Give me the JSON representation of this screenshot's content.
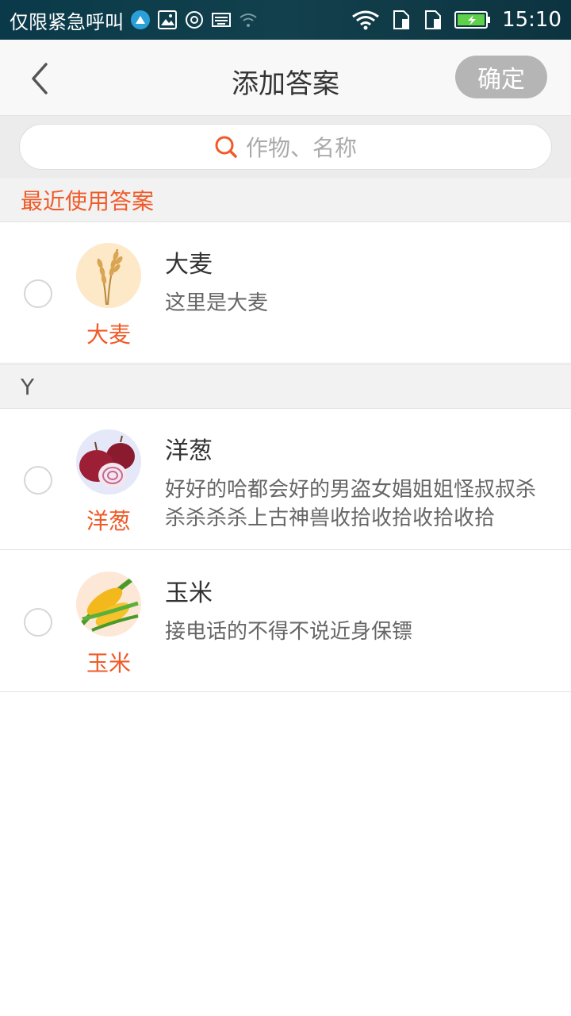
{
  "status_bar": {
    "carrier_text": "仅限紧急呼叫",
    "time": "15:10",
    "icons": [
      "cleaner-icon",
      "image-icon",
      "security-icon",
      "keyboard-icon",
      "wifi-question-icon",
      "wifi-icon",
      "sim1-icon",
      "sim2-icon",
      "battery-icon"
    ]
  },
  "nav": {
    "title": "添加答案",
    "confirm_label": "确定"
  },
  "search": {
    "placeholder": "作物、名称"
  },
  "sections": {
    "recent_label": "最近使用答案",
    "y_label": "Y"
  },
  "items": [
    {
      "name": "大麦",
      "thumb_label": "大麦",
      "desc": "这里是大麦",
      "icon": "barley-icon",
      "bg": "#fde8c8"
    },
    {
      "name": "洋葱",
      "thumb_label": "洋葱",
      "desc": "好好的哈都会好的男盗女娼姐姐怪叔叔杀杀杀杀杀上古神兽收拾收拾收拾收拾",
      "icon": "onion-icon",
      "bg": "#e4e8f8"
    },
    {
      "name": "玉米",
      "thumb_label": "玉米",
      "desc": "接电话的不得不说近身保镖",
      "icon": "corn-icon",
      "bg": "#fde8d8"
    }
  ],
  "colors": {
    "accent": "#f05a28",
    "confirm_disabled": "#b5b5b5"
  }
}
